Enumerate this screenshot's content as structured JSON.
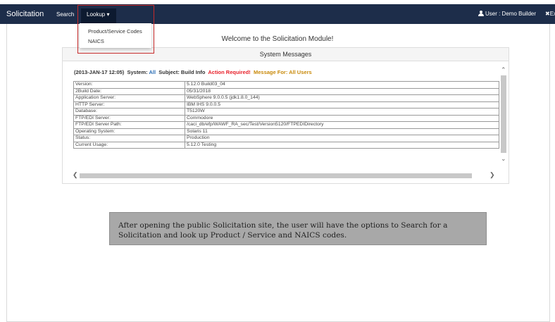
{
  "navbar": {
    "brand": "Solicitation",
    "search": "Search",
    "lookup": "Lookup ▾",
    "user": "User : Demo Builder",
    "exit_fragment": "✖Ex"
  },
  "lookup_menu": {
    "items": [
      "Product/Service Codes",
      "NAICS"
    ]
  },
  "welcome": "Welcome to the Solicitation Module!",
  "system_messages": {
    "title": "System Messages",
    "header": {
      "date": "(2013-JAN-17 12:05)",
      "system_label": "System:",
      "system_value": "All",
      "subject_label": "Subject:",
      "subject_value": "Build Info",
      "action": "Action Required!",
      "message_for": "Message For: All Users"
    },
    "rows": [
      [
        "Version:",
        "5.12.0 Build03_04"
      ],
      [
        "2Build Date:",
        "05/31/2018"
      ],
      [
        "Application Server:",
        "WebSphere 9.0.0.5 (jdk1.8.0_144)"
      ],
      [
        "HTTP Server:",
        "IBM IHS 9.0.0.5"
      ],
      [
        "Database:",
        "T5120W"
      ],
      [
        "FTP/EDI Server:",
        "Commodore"
      ],
      [
        "FTP/EDI Server Path:",
        "/caci_db/efp/WAWF_RA_sec/Test/Version5120/FTPEDIDirectory"
      ],
      [
        "Operating System:",
        "Solaris 11"
      ],
      [
        "Status:",
        "Production"
      ],
      [
        "Current Usage:",
        "5.12.0 Testing"
      ]
    ]
  },
  "caption": "After opening the public Solicitation site, the user will have the options to Search for a Solicitation and look up Product / Service and NAICS codes.",
  "colors": {
    "navbar": "#1d2d4a",
    "highlight_box": "#c62a2a",
    "system_value": "#2a6db5",
    "action_required": "#e8202a",
    "message_for": "#c98a0b",
    "caption_bg": "#a8a8a8"
  },
  "icons": {
    "user": "user-icon",
    "scroll_up": "chevron-up-icon",
    "scroll_down": "chevron-down-icon",
    "scroll_left": "chevron-left-icon",
    "scroll_right": "chevron-right-icon"
  }
}
